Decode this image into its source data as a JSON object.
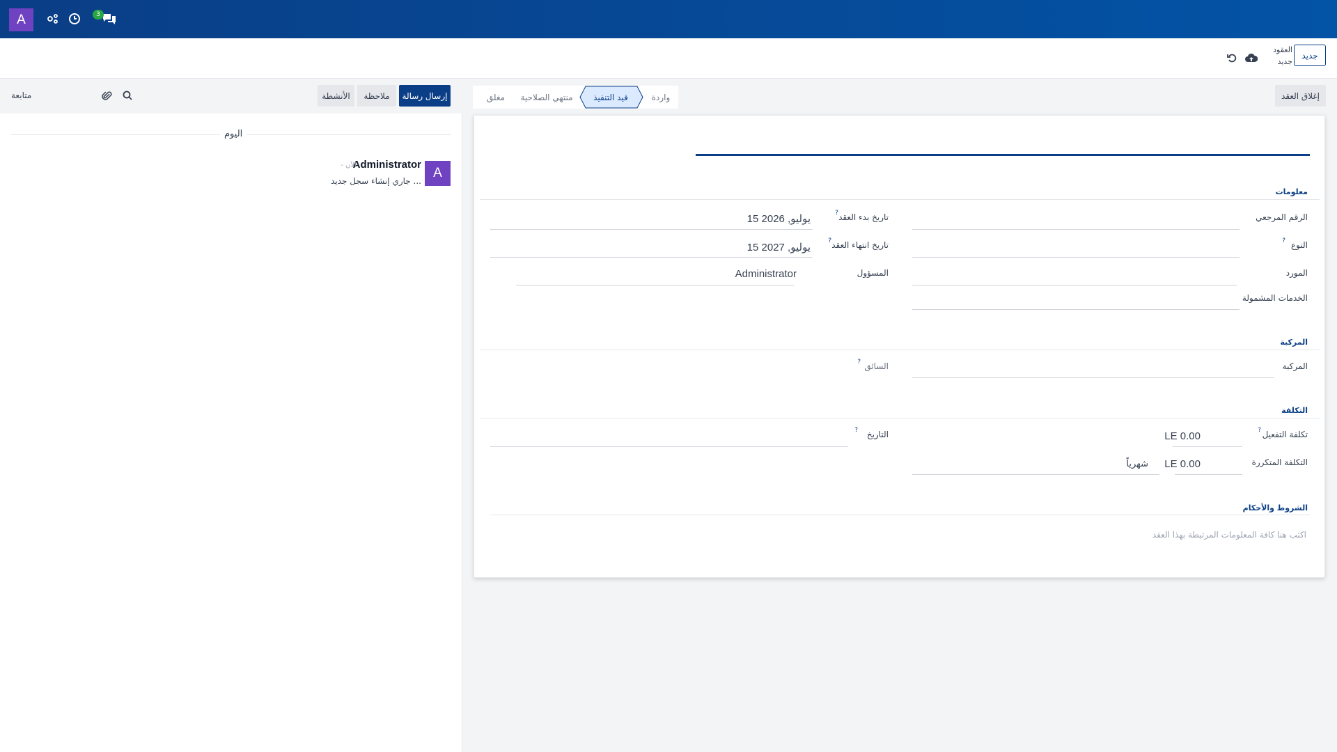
{
  "navbar": {
    "avatar_letter": "A",
    "messages_count": "3",
    "colors": {
      "primary": "#0a3e86",
      "avatar": "#6f42c1",
      "badge": "#28a745"
    }
  },
  "control_panel": {
    "new_label": "جديد",
    "breadcrumb_parent": "العقود",
    "breadcrumb_current": "جديد"
  },
  "chatter": {
    "send_message_label": "إرسال رسالة",
    "log_note_label": "ملاحظة",
    "activities_label": "الأنشطة",
    "follow_label": "متابعة",
    "today_label": "اليوم",
    "message": {
      "avatar_letter": "A",
      "author": "Administrator",
      "time": "- الآن",
      "body": "جاري إنشاء سجل جديد ..."
    }
  },
  "statusbar": {
    "close_contract_label": "إغلاق العقد",
    "stages": {
      "new": "واردة",
      "open": "قيد التنفيذ",
      "expired": "منتهي الصلاحية",
      "closed": "مغلق"
    },
    "active_stage": "open"
  },
  "form": {
    "sections": {
      "info": "معلومات",
      "vehicle": "المركبة",
      "cost": "التكلفة",
      "terms": "الشروط والأحكام"
    },
    "labels": {
      "reference": "الرقم المرجعي",
      "type": "النوع",
      "vendor": "المورد",
      "services": "الخدمات المشمولة",
      "start_date": "تاريخ بدء العقد",
      "end_date": "تاريخ انتهاء العقد",
      "responsible": "المسؤول",
      "vehicle": "المركبة",
      "driver": "السائق",
      "activation_cost": "تكلفة التفعيل",
      "recurring_cost": "التكلفة المتكررة",
      "date": "التاريخ"
    },
    "values": {
      "start_date": "15 يوليو, 2026",
      "end_date": "15 يوليو, 2027",
      "responsible": "Administrator",
      "activation_cost": "LE 0.00",
      "recurring_cost": "LE 0.00",
      "recurring_period": "شهرياً"
    },
    "help_mark": "?",
    "terms_placeholder": "اكتب هنا كافة المعلومات المرتبطة بهذا العقد"
  }
}
